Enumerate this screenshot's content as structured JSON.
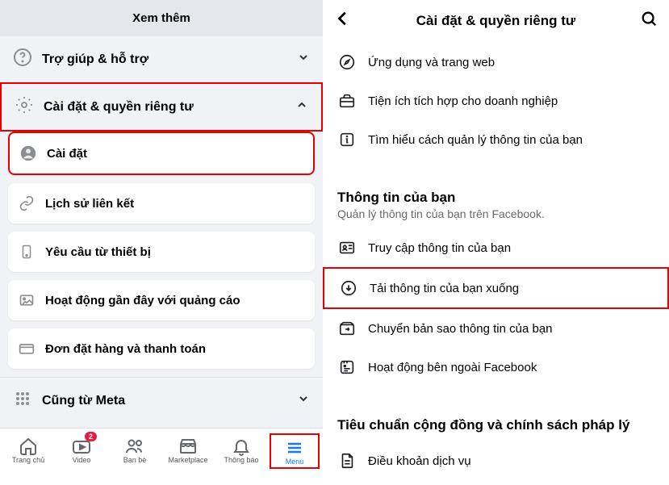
{
  "left": {
    "see_more": "Xem thêm",
    "help": "Trợ giúp & hỗ trợ",
    "settings_privacy": "Cài đặt & quyền riêng tư",
    "submenu": {
      "settings": "Cài đặt",
      "link_history": "Lịch sử liên kết",
      "device_requests": "Yêu cầu từ thiết bị",
      "recent_ad_activity": "Hoạt động gần đây với quảng cáo",
      "orders_payments": "Đơn đặt hàng và thanh toán"
    },
    "also_from_meta": "Cũng từ Meta"
  },
  "nav": {
    "home": "Trang chủ",
    "video": "Video",
    "video_badge": "2",
    "friends": "Bạn bè",
    "marketplace": "Marketplace",
    "notifications": "Thông báo",
    "menu": "Menu"
  },
  "right": {
    "title": "Cài đặt & quyền riêng tư",
    "items": {
      "apps_sites": "Ứng dụng và trang web",
      "business_integrations": "Tiện ích tích hợp cho doanh nghiệp",
      "learn_manage_info": "Tìm hiểu cách quản lý thông tin của bạn"
    },
    "your_info": {
      "title": "Thông tin của bạn",
      "subtitle": "Quản lý thông tin của bạn trên Facebook.",
      "access": "Truy cập thông tin của bạn",
      "download": "Tải thông tin của bạn xuống",
      "transfer": "Chuyển bản sao thông tin của bạn",
      "off_fb": "Hoạt động bên ngoài Facebook"
    },
    "standards": {
      "title": "Tiêu chuẩn cộng đồng và chính sách pháp lý",
      "terms": "Điều khoản dịch vụ"
    }
  }
}
